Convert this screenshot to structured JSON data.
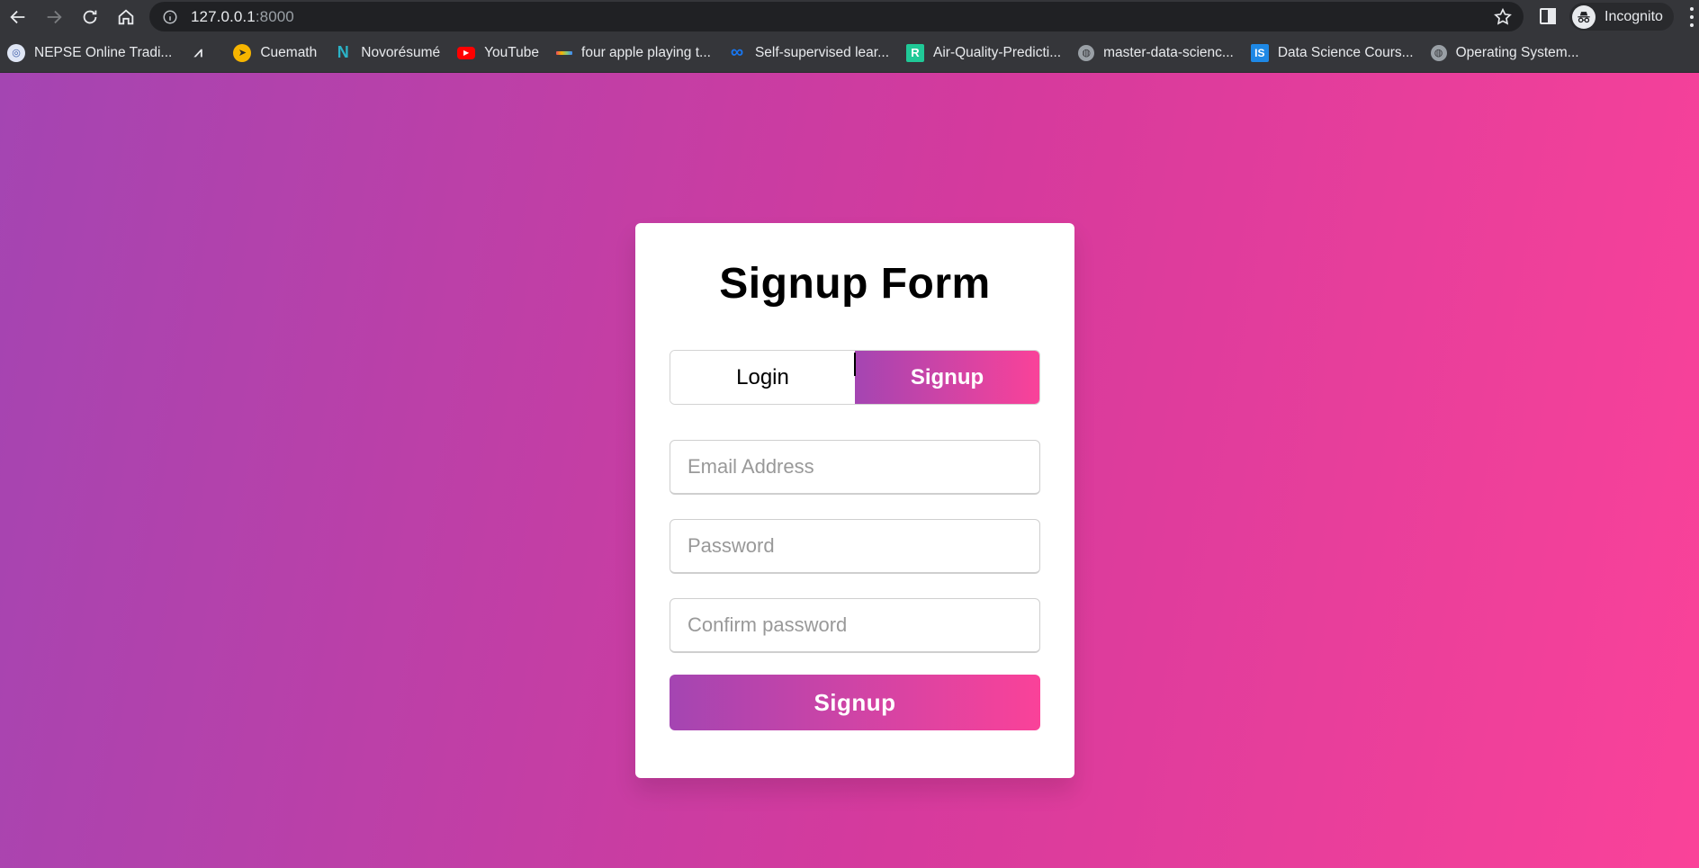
{
  "browser": {
    "url_host": "127.0.0.1",
    "url_port": ":8000",
    "profile_label": "Incognito",
    "bookmarks": [
      {
        "label": "NEPSE Online Tradi...",
        "icon": "globe-emblem-icon",
        "color": "#dfe6f5"
      },
      {
        "label": "",
        "icon": "zigzag-logo-icon",
        "color": "#e8eaed"
      },
      {
        "label": "Cuemath",
        "icon": "rocket-icon",
        "color": "#f7b500"
      },
      {
        "label": "Novorésumé",
        "icon": "n-logo-icon",
        "color": "#2bb3c7"
      },
      {
        "label": "YouTube",
        "icon": "youtube-icon",
        "color": "#ff0000"
      },
      {
        "label": "four apple playing t...",
        "icon": "color-bar-icon",
        "color": "#7fc97f"
      },
      {
        "label": "Self-supervised lear...",
        "icon": "meta-infinity-icon",
        "color": "#1877f2"
      },
      {
        "label": "Air-Quality-Predicti...",
        "icon": "r-logo-icon",
        "color": "#20c997"
      },
      {
        "label": "master-data-scienc...",
        "icon": "globe-icon",
        "color": "#9aa0a6"
      },
      {
        "label": "Data Science Cours...",
        "icon": "is-logo-icon",
        "color": "#1e88e5"
      },
      {
        "label": "Operating System...",
        "icon": "globe-icon",
        "color": "#9aa0a6"
      }
    ]
  },
  "form": {
    "title": "Signup Form",
    "tabs": {
      "login": "Login",
      "signup": "Signup"
    },
    "email_placeholder": "Email Address",
    "password_placeholder": "Password",
    "confirm_placeholder": "Confirm password",
    "submit_label": "Signup"
  },
  "colors": {
    "gradient_start": "#a445b2",
    "gradient_end": "#fa4299"
  }
}
